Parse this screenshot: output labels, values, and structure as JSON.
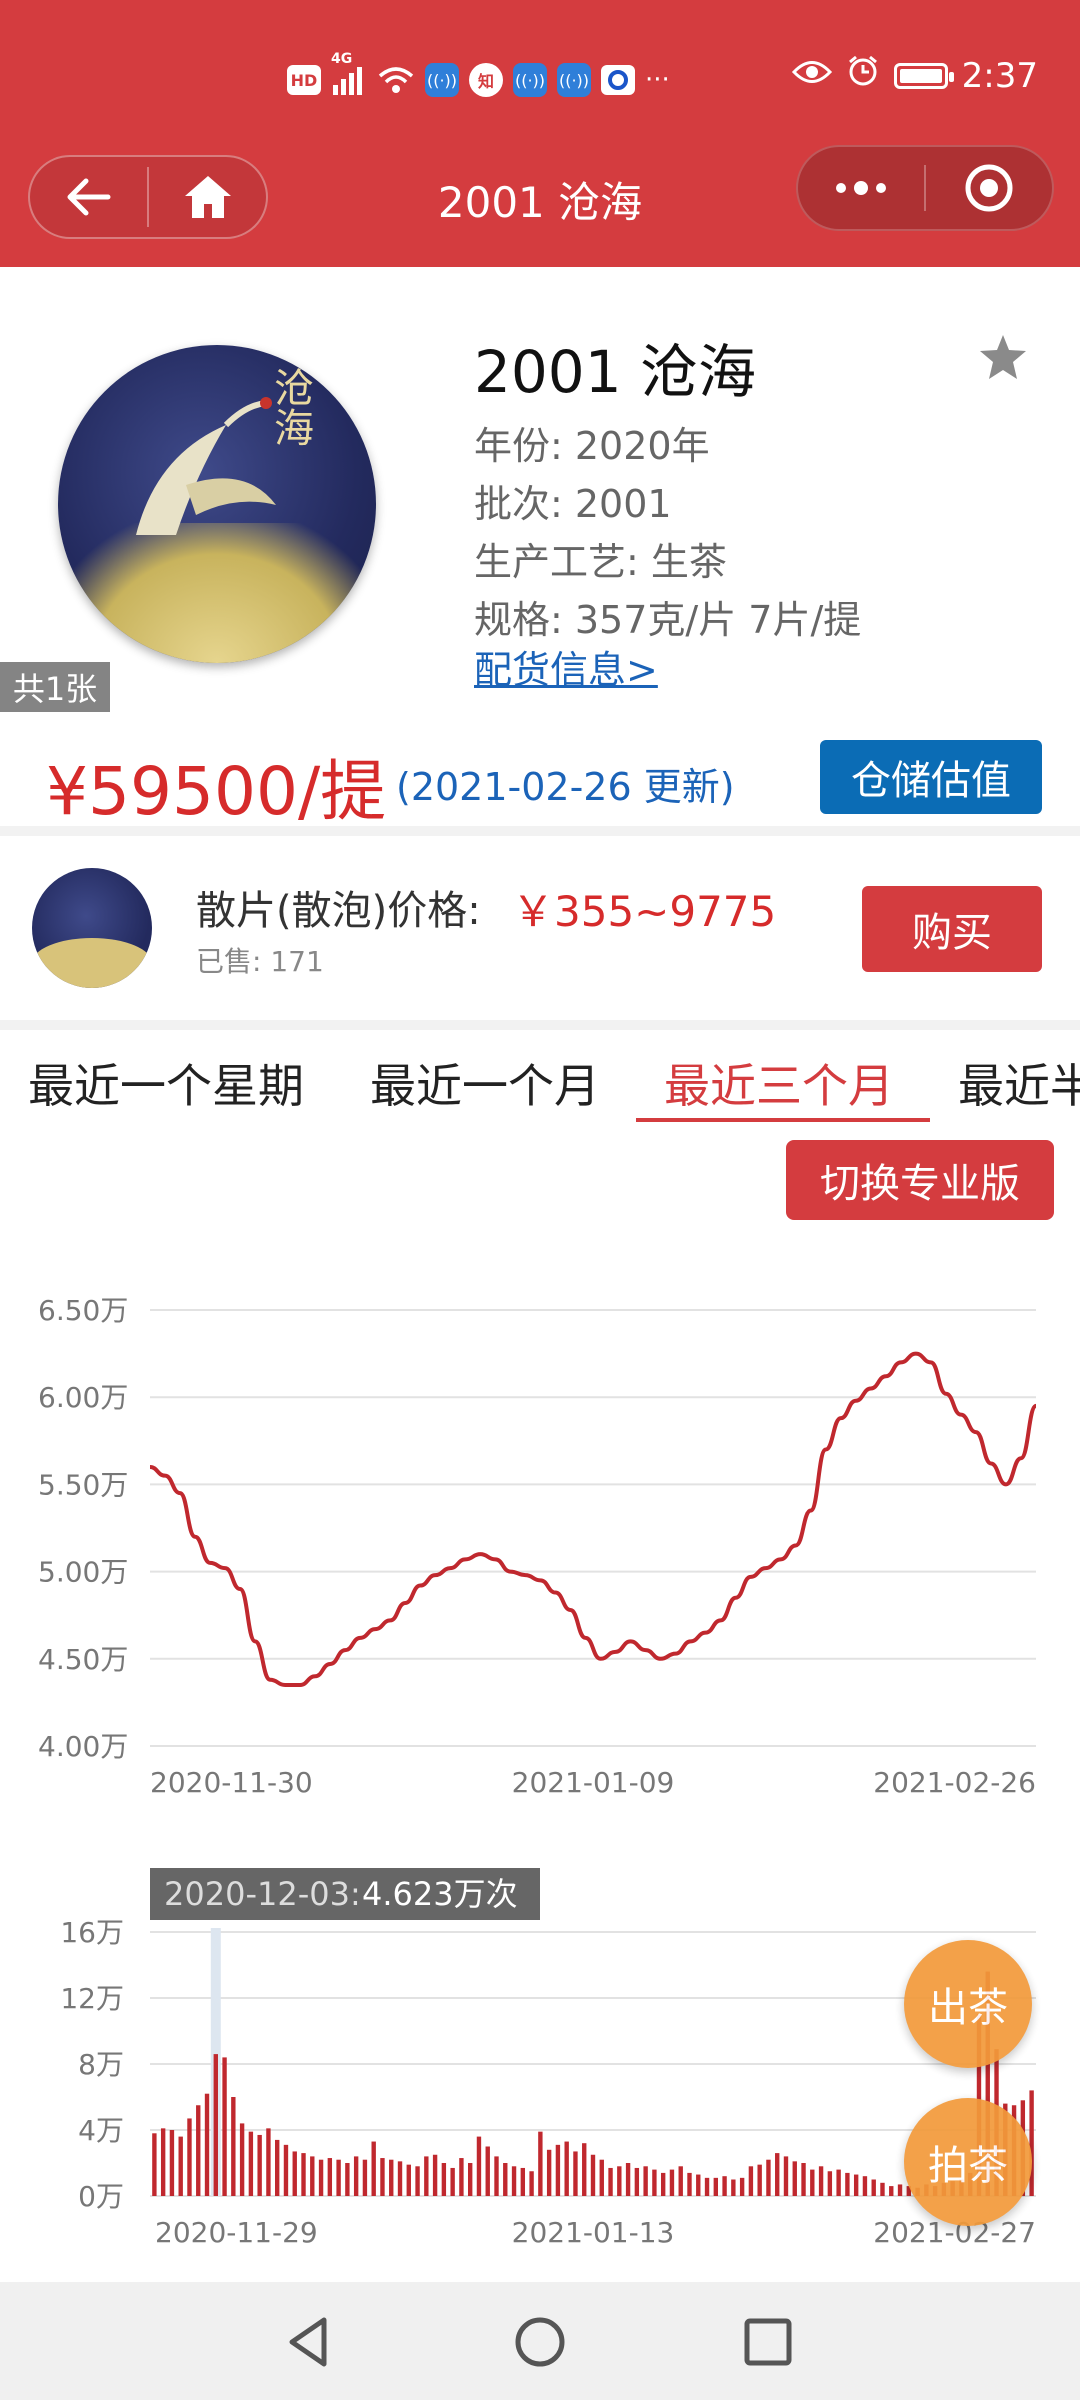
{
  "status_bar": {
    "time": "2:37",
    "icons": [
      "hd-icon",
      "signal-4g-icon",
      "wifi-icon",
      "hotspot-icon",
      "zhihu-icon",
      "hotspot-icon",
      "hotspot-icon",
      "app-icon",
      "more-dots-icon",
      "eye-icon",
      "alarm-icon",
      "battery-icon"
    ],
    "hd": "HD",
    "net": "4G",
    "zhihu": "知",
    "dots": "···"
  },
  "header": {
    "title": "2001 沧海"
  },
  "product": {
    "title": "2001 沧海",
    "year_line": "年份: 2020年",
    "batch_line": "批次: 2001",
    "process_line": "生产工艺: 生茶",
    "spec_line": "规格: 357克/片 7片/提",
    "link": "配货信息>",
    "image_count": "共1张",
    "cake_chars": "沧海"
  },
  "price": {
    "value": "¥59500/提",
    "updated": "(2021-02-26 更新)",
    "storage_button": "仓储估值"
  },
  "loose": {
    "label": "散片(散泡)价格:",
    "price": "￥355~9775",
    "sold": "已售: 171",
    "buy_button": "购买"
  },
  "tabs": [
    "最近一个星期",
    "最近一个月",
    "最近三个月",
    "最近半"
  ],
  "active_tab": 2,
  "switch_button": "切换专业版",
  "chart_data": [
    {
      "type": "line",
      "title": "",
      "y_ticks": [
        "6.50万",
        "6.00万",
        "5.50万",
        "5.00万",
        "4.50万",
        "4.00万"
      ],
      "ylim": [
        4.0,
        6.5
      ],
      "x_ticks": [
        "2020-11-30",
        "2021-01-09",
        "2021-02-26"
      ],
      "grid": true,
      "color": "#c0282e",
      "values": [
        5.6,
        5.55,
        5.45,
        5.2,
        5.05,
        5.02,
        4.9,
        4.6,
        4.38,
        4.35,
        4.35,
        4.4,
        4.47,
        4.55,
        4.62,
        4.67,
        4.72,
        4.82,
        4.92,
        4.98,
        5.02,
        5.07,
        5.1,
        5.07,
        5.0,
        4.98,
        4.95,
        4.88,
        4.78,
        4.62,
        4.5,
        4.54,
        4.6,
        4.55,
        4.5,
        4.53,
        4.6,
        4.65,
        4.72,
        4.85,
        4.97,
        5.02,
        5.07,
        5.15,
        5.35,
        5.7,
        5.88,
        5.98,
        6.05,
        6.12,
        6.2,
        6.25,
        6.2,
        6.02,
        5.9,
        5.8,
        5.62,
        5.5,
        5.65,
        5.95
      ]
    },
    {
      "type": "bar",
      "title": "",
      "y_ticks": [
        "16万",
        "12万",
        "8万",
        "4万",
        "0万"
      ],
      "ylim": [
        0,
        16
      ],
      "x_ticks": [
        "2020-11-29",
        "2021-01-13",
        "2021-02-27"
      ],
      "grid": true,
      "color": "#c0282e",
      "tooltip": {
        "date": "2020-12-03:",
        "value": "4.623万次"
      },
      "highlight_index": 7,
      "values": [
        3.8,
        4.1,
        4.0,
        3.6,
        4.7,
        5.5,
        6.2,
        8.6,
        8.4,
        6.0,
        4.4,
        3.9,
        3.7,
        4.1,
        3.4,
        3.1,
        2.7,
        2.6,
        2.4,
        2.2,
        2.3,
        2.2,
        2.0,
        2.4,
        2.2,
        3.3,
        2.3,
        2.2,
        2.1,
        1.9,
        1.8,
        2.4,
        2.5,
        2.0,
        1.7,
        2.3,
        2.0,
        3.6,
        3.0,
        2.4,
        2.0,
        1.8,
        1.7,
        1.5,
        3.9,
        2.8,
        3.1,
        3.3,
        2.7,
        3.2,
        2.5,
        2.2,
        1.7,
        1.8,
        2.0,
        1.7,
        1.8,
        1.6,
        1.4,
        1.6,
        1.8,
        1.4,
        1.3,
        1.1,
        1.1,
        1.2,
        1.0,
        1.1,
        1.8,
        1.9,
        2.2,
        2.6,
        2.4,
        2.1,
        2.0,
        1.6,
        1.8,
        1.5,
        1.6,
        1.4,
        1.3,
        1.2,
        1.0,
        0.8,
        0.6,
        0.7,
        0.6,
        0.5,
        0.7,
        0.6,
        0.8,
        0.9,
        1.0,
        1.4,
        11.0,
        13.6,
        8.9,
        5.6,
        5.5,
        5.8,
        6.4
      ]
    }
  ],
  "fab": {
    "out": "出茶",
    "in": "拍茶"
  }
}
